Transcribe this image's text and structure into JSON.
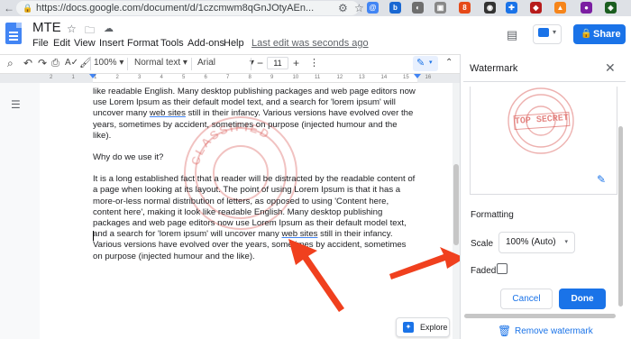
{
  "browser": {
    "url": "https://docs.google.com/document/d/1czcmwm8qGnJOtyAEn..."
  },
  "doc": {
    "title": "MTE",
    "menu": [
      "File",
      "Edit",
      "View",
      "Insert",
      "Format",
      "Tools",
      "Add-ons",
      "Help"
    ],
    "last_edit": "Last edit was seconds ago",
    "share_label": "Share",
    "explore_label": "Explore"
  },
  "toolbar": {
    "zoom": "100%",
    "style": "Normal text",
    "font": "Arial",
    "font_size": "11",
    "minus": "−",
    "plus": "+",
    "more": "⋮"
  },
  "ruler": [
    "2",
    "1",
    "1",
    "2",
    "3",
    "4",
    "5",
    "6",
    "7",
    "8",
    "9",
    "10",
    "11",
    "12",
    "13",
    "14",
    "15",
    "16"
  ],
  "body": {
    "p1a": "like readable English. Many desktop publishing packages and web page editors now use Lorem Ipsum as their default model text, and a search for 'lorem ipsum' will uncover many ",
    "p1link": "web sites",
    "p1b": " still in their infancy. Various versions have evolved over the years, sometimes by accident, sometimes on purpose (injected humour and the like).",
    "p2": "Why do we use it?",
    "p3a": "It is a long established fact that a reader will be distracted by the readable content of a page when looking at its layout. The point of using Lorem Ipsum is that it has a more-or-less normal distribution of letters, as opposed to using 'Content here, content here', making it look like readable English. Many desktop publishing packages and web page editors now use Lorem Ipsum as their default model text, and a search for 'lorem ipsum' will uncover many ",
    "p3link": "web sites",
    "p3b": " still in their infancy. Various versions have evolved over the years, sometimes by accident, sometimes on purpose (injected humour and the like)."
  },
  "watermark_panel": {
    "title": "Watermark",
    "stamp_text": "TOP SECRET",
    "stamp_ring": "CLASSIFIED",
    "formatting_label": "Formatting",
    "scale_label": "Scale",
    "scale_value": "100% (Auto)",
    "faded_label": "Faded",
    "faded_checked": false,
    "cancel_label": "Cancel",
    "done_label": "Done",
    "remove_label": "Remove watermark"
  },
  "colors": {
    "accent": "#1a73e8",
    "stamp": "#d9534f",
    "arrow": "#f0401e"
  }
}
